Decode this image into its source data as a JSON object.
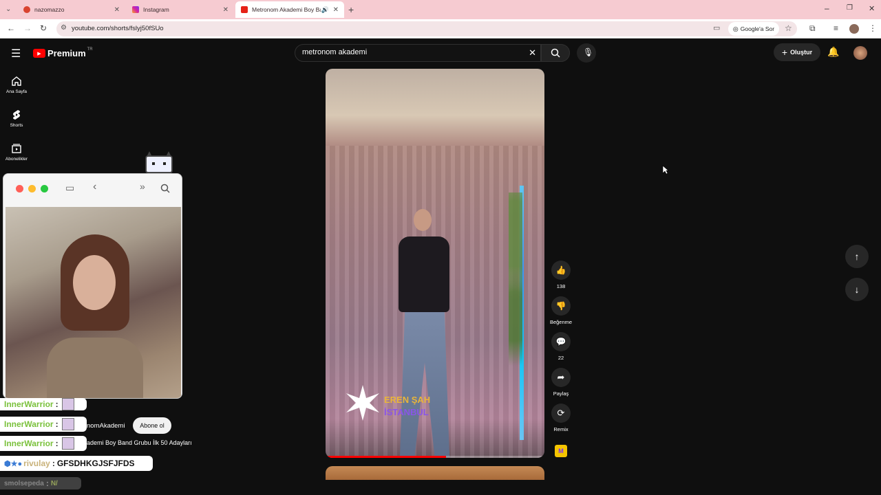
{
  "tabs": [
    {
      "title": "nazomazzo",
      "color": "#d9432f"
    },
    {
      "title": "Instagram",
      "color": "#d6249f"
    },
    {
      "title": "Metronom Akademi Boy Ba",
      "color": "#e62117"
    }
  ],
  "address": {
    "url": "youtube.com/shorts/fslyj50fSUo",
    "google_btn": "Google'a Sor"
  },
  "yt": {
    "logo": "Premium",
    "region": "TR",
    "search_value": "metronom akademi",
    "create_label": "Oluştur",
    "nav": [
      {
        "label": "Ana Sayfa",
        "icon": "home-icon"
      },
      {
        "label": "Shorts",
        "icon": "shorts-icon"
      },
      {
        "label": "Abonelikler",
        "icon": "subscriptions-icon"
      }
    ],
    "actions": {
      "likes": "138",
      "dislike": "Beğenme",
      "comments": "22",
      "share": "Paylaş",
      "remix": "Remix"
    },
    "video_overlay": {
      "line1": "EREN ŞAH",
      "line2": "İSTANBUL"
    },
    "channel": "nomAkademi",
    "subscribe": "Abone ol",
    "video_title": "ademi Boy Band Grubu İlk 50 Adayları"
  },
  "chat": [
    {
      "user": "InnerWarrior",
      "text": ""
    },
    {
      "user": "InnerWarrior",
      "text": ""
    },
    {
      "user": "InnerWarrior",
      "text": ""
    },
    {
      "user": "rivulay",
      "text": "GFSDHKGJSFJFDS"
    },
    {
      "user": "smolsepeda",
      "text": "N/"
    }
  ]
}
